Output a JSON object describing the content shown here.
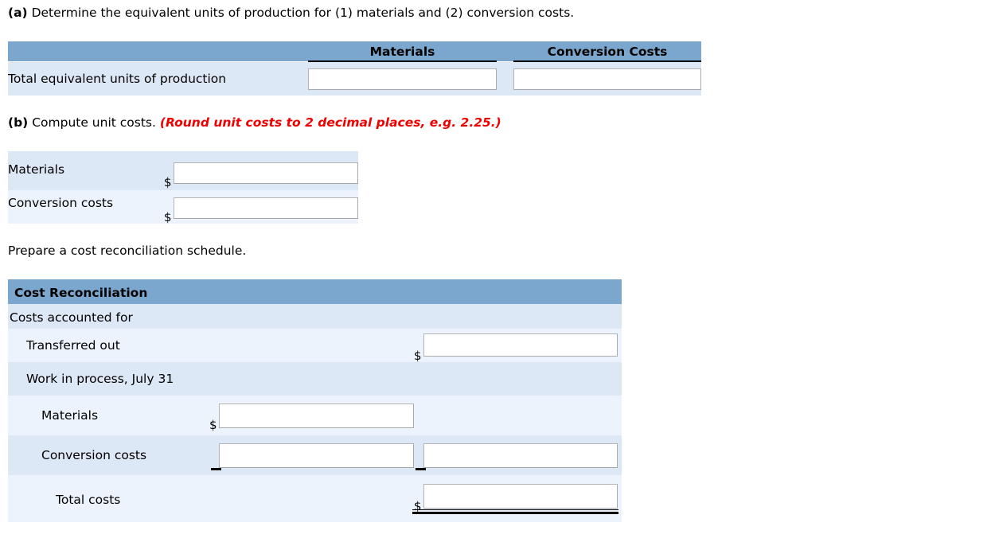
{
  "part_a": {
    "marker": "(a)",
    "prompt": "Determine the equivalent units of production for (1) materials and (2) conversion costs.",
    "table": {
      "headers": [
        "",
        "Materials",
        "Conversion Costs"
      ],
      "rows": [
        {
          "label": "Total equivalent units of production",
          "materials_value": "",
          "conversion_value": ""
        }
      ]
    }
  },
  "part_b": {
    "marker": "(b)",
    "prompt": "Compute unit costs.",
    "note": "(Round unit costs to 2 decimal places, e.g. 2.25.)",
    "note_color": "#ee0000",
    "rows": [
      {
        "label": "Materials",
        "currency": "$",
        "value": ""
      },
      {
        "label": "Conversion costs",
        "currency": "$",
        "value": ""
      }
    ]
  },
  "part_c": {
    "prompt": "Prepare a cost reconciliation schedule.",
    "table": {
      "title": "Cost Reconciliation",
      "rows": [
        {
          "label": "Costs accounted for",
          "indent": 0,
          "currency": "",
          "value": null,
          "second_value": null
        },
        {
          "label": "Transferred out",
          "indent": 1,
          "currency": "$",
          "value": "",
          "second_value": null
        },
        {
          "label": "Work in process, July 31",
          "indent": 1,
          "currency": "",
          "value": null,
          "second_value": null
        },
        {
          "label": "Materials",
          "indent": 2,
          "currency": "$",
          "value": "",
          "second_value": null
        },
        {
          "label": "Conversion costs",
          "indent": 2,
          "currency": "",
          "value": "",
          "second_value": ""
        },
        {
          "label": "Total costs",
          "indent": 3,
          "currency": "$",
          "value": "",
          "second_value": null
        }
      ]
    }
  },
  "colors": {
    "band_blue": "#7BA7CF",
    "row_dark": "#DCE8F5",
    "row_light": "#EDF3FC",
    "field_border": "#a9a9a9",
    "red_note": "#ee0000"
  }
}
